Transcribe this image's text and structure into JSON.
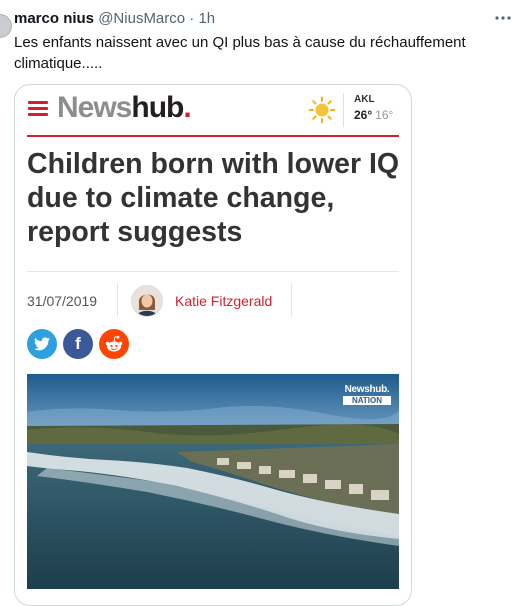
{
  "tweet": {
    "name": "marco nius",
    "handle": "@NiusMarco",
    "separator": "·",
    "time": "1h",
    "more_icon": "more-horizontal-icon",
    "text": "Les enfants naissent avec un QI plus bas à cause du réchauffement climatique....."
  },
  "card": {
    "logo": {
      "part1": "News",
      "part2": "hub",
      "part3": "."
    },
    "weather": {
      "icon": "sun-icon",
      "city": "AKL",
      "high": "26°",
      "low": "16°"
    },
    "headline": "Children born with lower IQ due to climate change, report suggests",
    "date": "31/07/2019",
    "author": "Katie Fitzgerald",
    "share": {
      "twitter_icon": "twitter-icon",
      "facebook_label": "f",
      "reddit_icon": "reddit-icon"
    },
    "photo_watermark": {
      "line1": "Newshub.",
      "line2": "NATION"
    },
    "colors": {
      "brand_red": "#d1202f",
      "twitter_blue": "#2fa0df",
      "facebook_blue": "#3b5998",
      "reddit_orange": "#ff4500"
    }
  }
}
